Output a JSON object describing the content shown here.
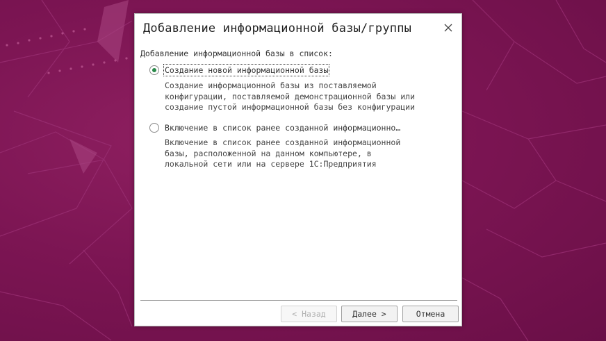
{
  "dialog": {
    "title": "Добавление информационной базы/группы",
    "section_label": "Добавление информационной базы в список:",
    "options": [
      {
        "label": "Создание новой информационной базы",
        "selected": true,
        "description_lines": [
          "Создание информационной базы из поставляемой",
          "конфигурации, поставляемой демонстрационной базы или",
          "создание пустой информационной базы без конфигурации"
        ]
      },
      {
        "label": "Включение в список ранее созданной информационно…",
        "selected": false,
        "description_lines": [
          "Включение в список ранее созданной информационной",
          "базы, расположенной на данном компьютере,  в",
          "локальной сети или на сервере 1С:Предприятия"
        ]
      }
    ],
    "buttons": {
      "back": "< Назад",
      "next": "Далее >",
      "cancel": "Отмена"
    }
  },
  "icons": {
    "close": "close-icon",
    "radio_selected": "radio-selected",
    "radio_unselected": "radio-unselected"
  },
  "colors": {
    "desktop_bg": "#7c1553",
    "radio_accent": "#2a8a4a"
  }
}
